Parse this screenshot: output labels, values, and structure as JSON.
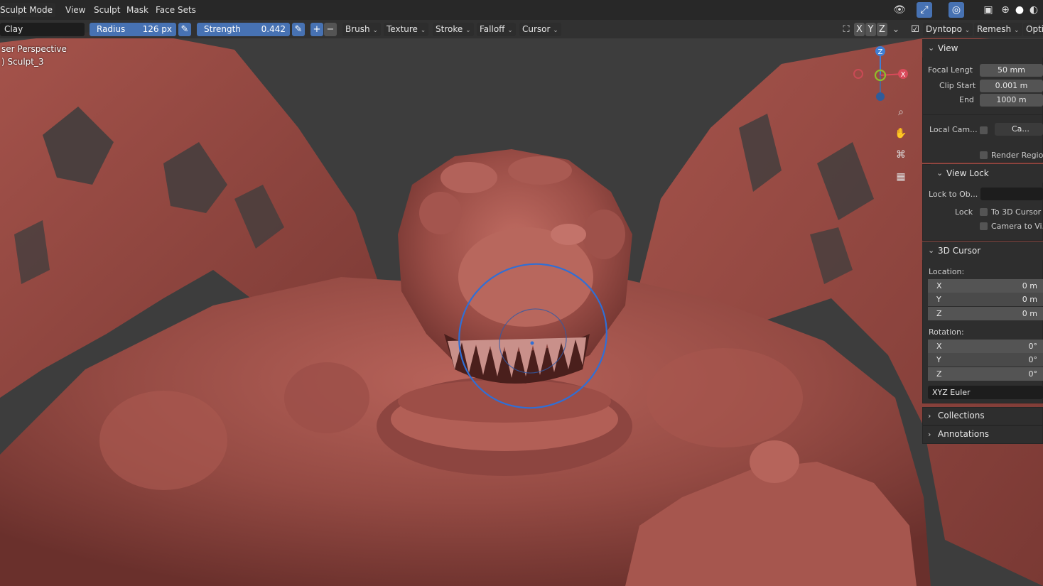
{
  "header": {
    "mode": "Sculpt Mode",
    "menus": [
      "View",
      "Sculpt",
      "Mask",
      "Face Sets"
    ]
  },
  "toolbar": {
    "brush_name": "Clay",
    "radius_label": "Radius",
    "radius_value": "126 px",
    "strength_label": "Strength",
    "strength_value": "0.442",
    "plus": "+",
    "minus": "−",
    "menus": [
      "Brush",
      "Texture",
      "Stroke",
      "Falloff",
      "Cursor"
    ],
    "axes": [
      "X",
      "Y",
      "Z"
    ],
    "dyntopo": "Dyntopo",
    "remesh": "Remesh",
    "options": "Opti"
  },
  "overlay": {
    "line1": "ser Perspective",
    "line2": ") Sculpt_3"
  },
  "gizmo": {
    "z": "Z",
    "x": "X"
  },
  "panel": {
    "view": {
      "title": "View",
      "focal_label": "Focal Lengt",
      "focal_value": "50 mm",
      "clip_start_label": "Clip Start",
      "clip_start_value": "0.001 m",
      "end_label": "End",
      "end_value": "1000 m",
      "local_cam_label": "Local Cam...",
      "local_cam_value": "Ca...",
      "render_region_label": "Render Region"
    },
    "view_lock": {
      "title": "View Lock",
      "lock_to_obj_label": "Lock to Ob...",
      "lock_label": "Lock",
      "to_3d_cursor": "To 3D Cursor",
      "camera_to_view": "Camera to Vi..."
    },
    "cursor": {
      "title": "3D Cursor",
      "location_label": "Location:",
      "location": [
        {
          "axis": "X",
          "value": "0 m"
        },
        {
          "axis": "Y",
          "value": "0 m"
        },
        {
          "axis": "Z",
          "value": "0 m"
        }
      ],
      "rotation_label": "Rotation:",
      "rotation": [
        {
          "axis": "X",
          "value": "0°"
        },
        {
          "axis": "Y",
          "value": "0°"
        },
        {
          "axis": "Z",
          "value": "0°"
        }
      ],
      "mode": "XYZ Euler"
    },
    "collections": {
      "title": "Collections"
    },
    "annotations": {
      "title": "Annotations"
    }
  },
  "colors": {
    "accent": "#4772b3",
    "brush_ring": "#2f6fd6",
    "sculpt_base": "#8e4540",
    "sculpt_highlight": "#b8635a"
  }
}
